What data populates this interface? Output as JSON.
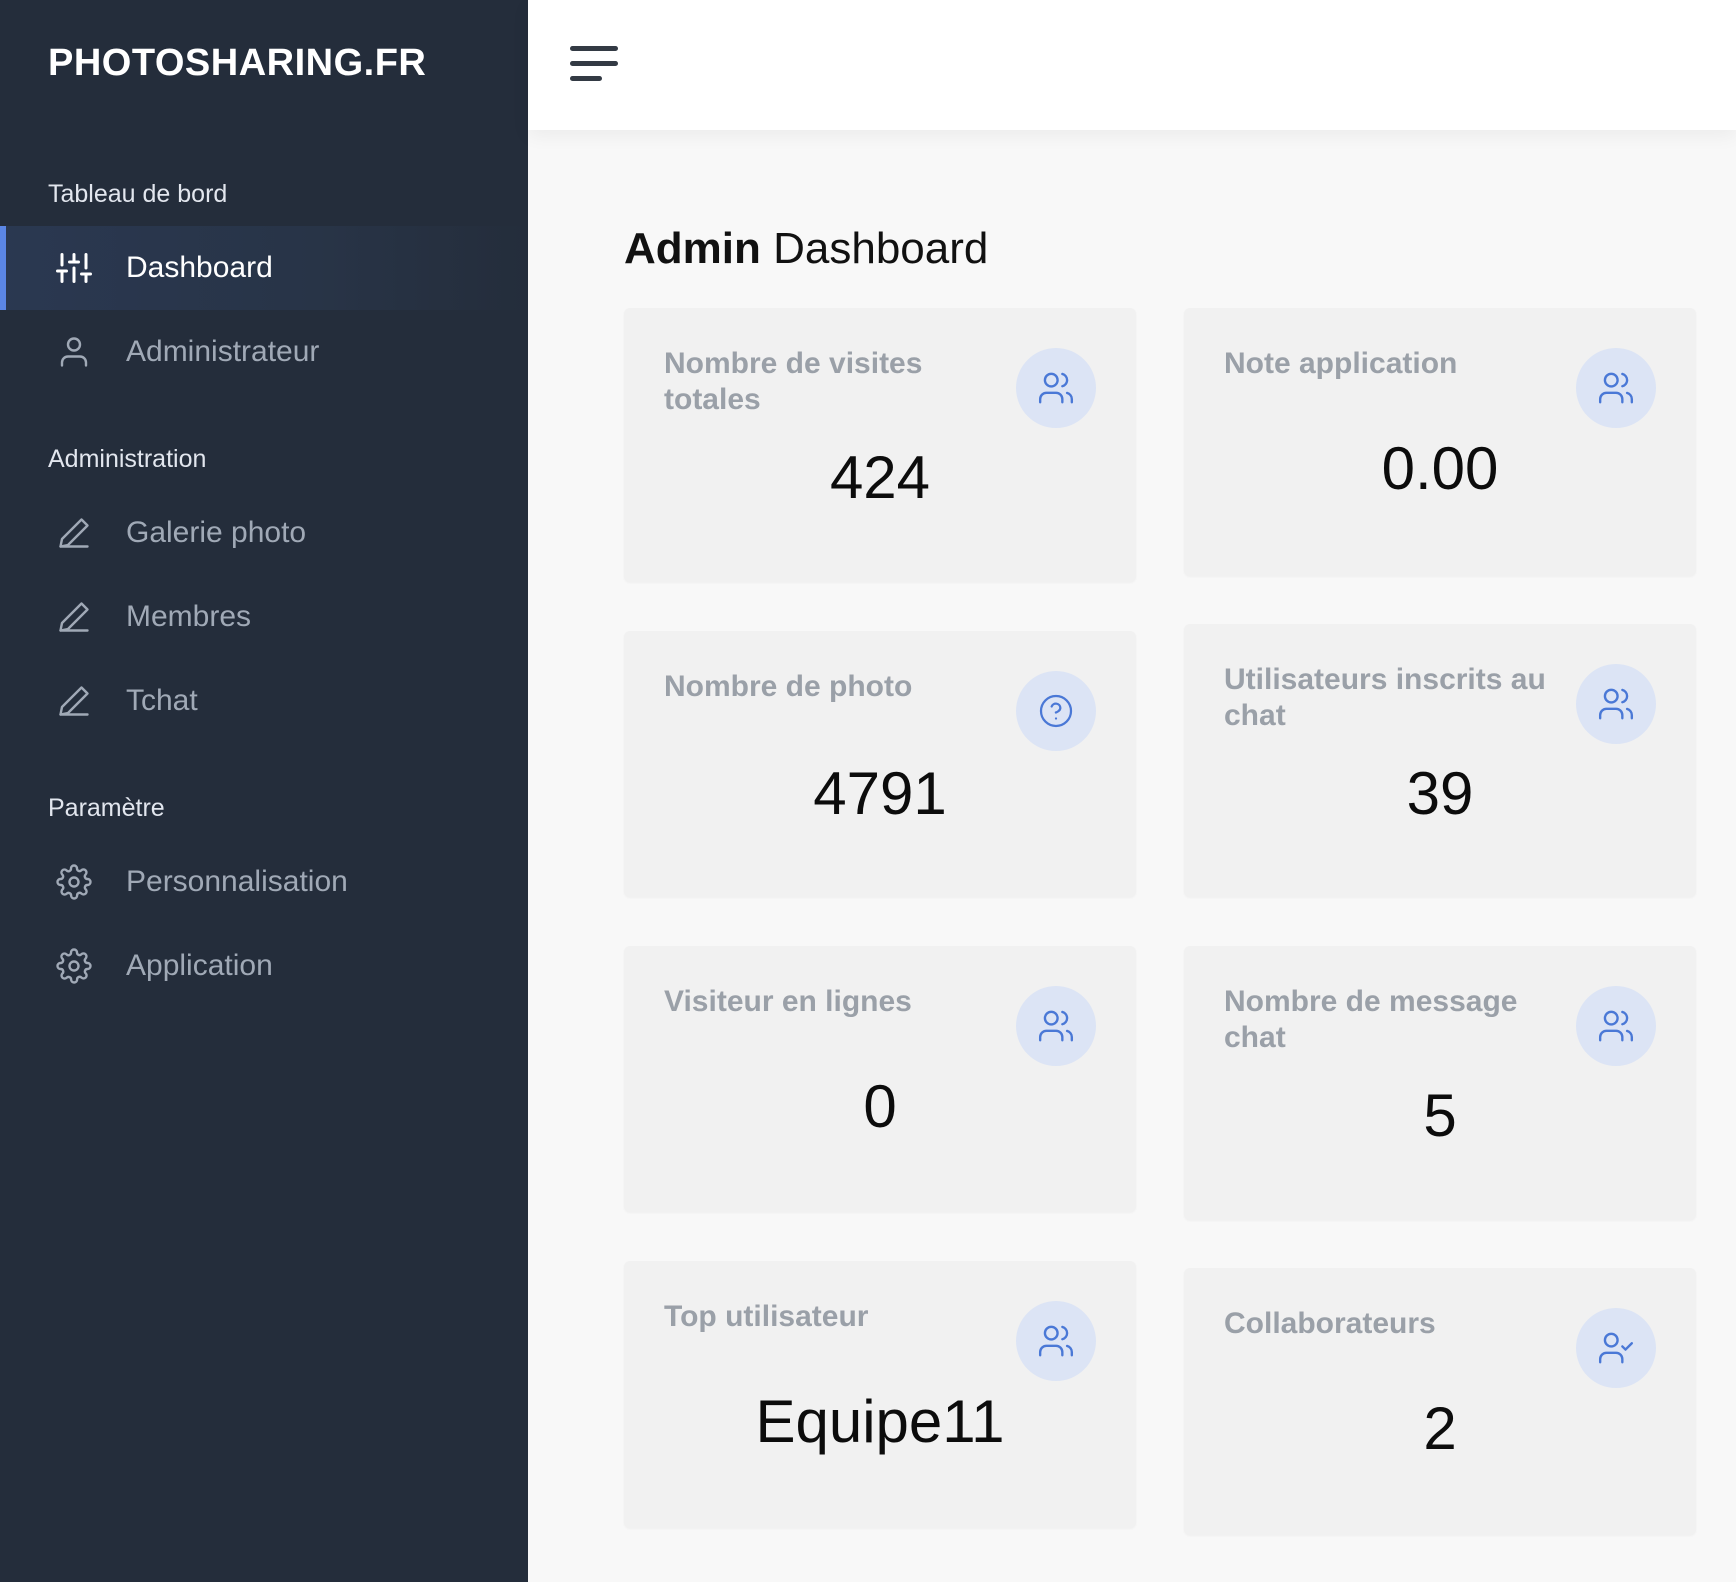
{
  "brand": "PHOTOSHARING.FR",
  "sidebar": {
    "sections": [
      {
        "label": "Tableau de bord"
      },
      {
        "label": "Administration"
      },
      {
        "label": "Paramètre"
      }
    ],
    "items": [
      {
        "label": "Dashboard",
        "icon": "sliders-icon"
      },
      {
        "label": "Administrateur",
        "icon": "user-icon"
      },
      {
        "label": "Galerie photo",
        "icon": "pencil-icon"
      },
      {
        "label": "Membres",
        "icon": "pencil-icon"
      },
      {
        "label": "Tchat",
        "icon": "pencil-icon"
      },
      {
        "label": "Personnalisation",
        "icon": "gear-icon"
      },
      {
        "label": "Application",
        "icon": "gear-icon"
      }
    ],
    "active": "Dashboard"
  },
  "main": {
    "title_bold": "Admin",
    "title_rest": " Dashboard",
    "cards": [
      {
        "title": "Nombre de visites totales",
        "value": "424",
        "icon": "users-icon"
      },
      {
        "title": "Note application",
        "value": "0.00",
        "icon": "users-icon"
      },
      {
        "title": "Nombre de photo",
        "value": "4791",
        "icon": "help-circle-icon"
      },
      {
        "title": "Utilisateurs inscrits au chat",
        "value": "39",
        "icon": "users-icon"
      },
      {
        "title": "Visiteur en lignes",
        "value": "0",
        "icon": "users-icon"
      },
      {
        "title": "Nombre de message chat",
        "value": "5",
        "icon": "users-icon"
      },
      {
        "title": "Top utilisateur",
        "value": "Equipe11",
        "icon": "users-icon"
      },
      {
        "title": "Collaborateurs",
        "value": "2",
        "icon": "user-check-icon"
      }
    ]
  },
  "colors": {
    "sidebar_bg": "#242d3b",
    "active_accent": "#5b86e5",
    "icon_circle_bg": "#dce4f5",
    "icon_stroke": "#4a78d6",
    "card_bg": "#f1f1f1"
  }
}
